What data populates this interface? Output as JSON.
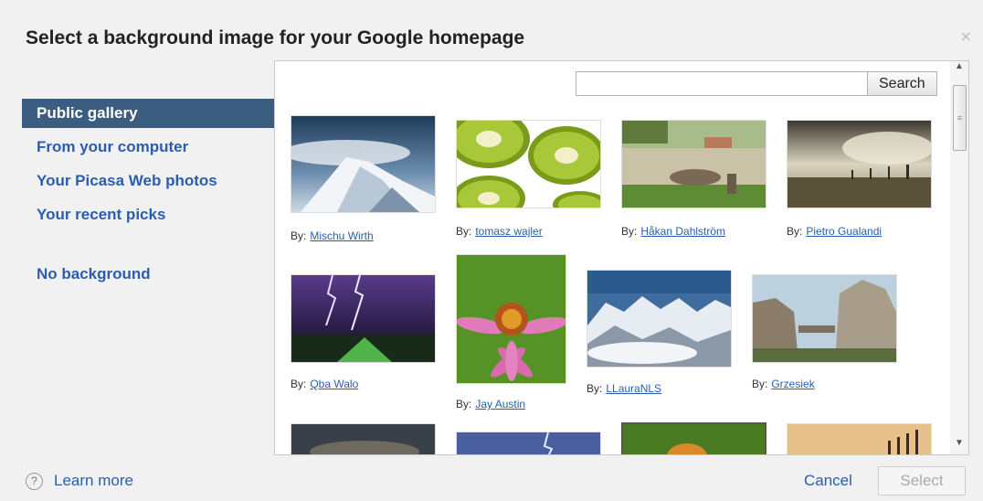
{
  "dialog": {
    "title": "Select a background image for your Google homepage",
    "close_glyph": "×"
  },
  "sidebar": {
    "items": [
      {
        "label": "Public gallery",
        "active": true
      },
      {
        "label": "From your computer"
      },
      {
        "label": "Your Picasa Web photos"
      },
      {
        "label": "Your recent picks"
      }
    ],
    "no_background": "No background"
  },
  "search": {
    "value": "",
    "placeholder": "",
    "button_label": "Search"
  },
  "gallery": {
    "by_label": "By:",
    "photos": [
      {
        "author": "Mischu Wirth",
        "subject": "snowy mountain peak"
      },
      {
        "author": "tomasz wajler",
        "subject": "kiwi slices"
      },
      {
        "author": "Håkan Dahlström",
        "subject": "garden statue"
      },
      {
        "author": "Pietro Gualandi",
        "subject": "sepia landscape"
      },
      {
        "author": "Qba Walo",
        "subject": "lightning storm"
      },
      {
        "author": "Jay Austin",
        "subject": "pink coneflower"
      },
      {
        "author": "LLauraNLS",
        "subject": "mountain range"
      },
      {
        "author": "Grzesiek",
        "subject": "rock formations"
      }
    ]
  },
  "footer": {
    "help_glyph": "?",
    "learn_more": "Learn more",
    "cancel": "Cancel",
    "select": "Select"
  },
  "colors": {
    "accent": "#2a5db0",
    "active_nav": "#3b5e80"
  }
}
